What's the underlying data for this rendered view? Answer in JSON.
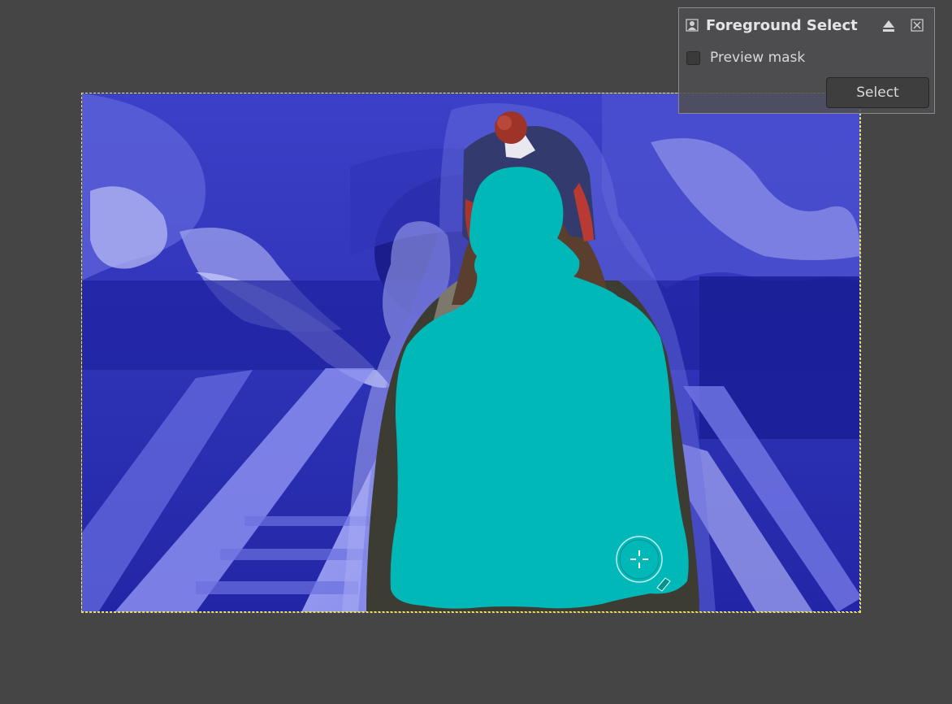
{
  "panel": {
    "title": "Foreground Select",
    "tool_icon": "foreground-select-tool-icon",
    "detach_icon": "eject-icon",
    "close_icon": "close-icon",
    "preview_mask": {
      "label": "Preview mask",
      "checked": false
    },
    "select_button_label": "Select"
  },
  "canvas": {
    "mask_overlay_color": "#2b2fb0",
    "foreground_mask_color": "#00b8b8",
    "selection_outline_color": "#f1e36a",
    "cursor_icon": "move-crosshair-cursor-icon",
    "background_color": "#454545"
  }
}
